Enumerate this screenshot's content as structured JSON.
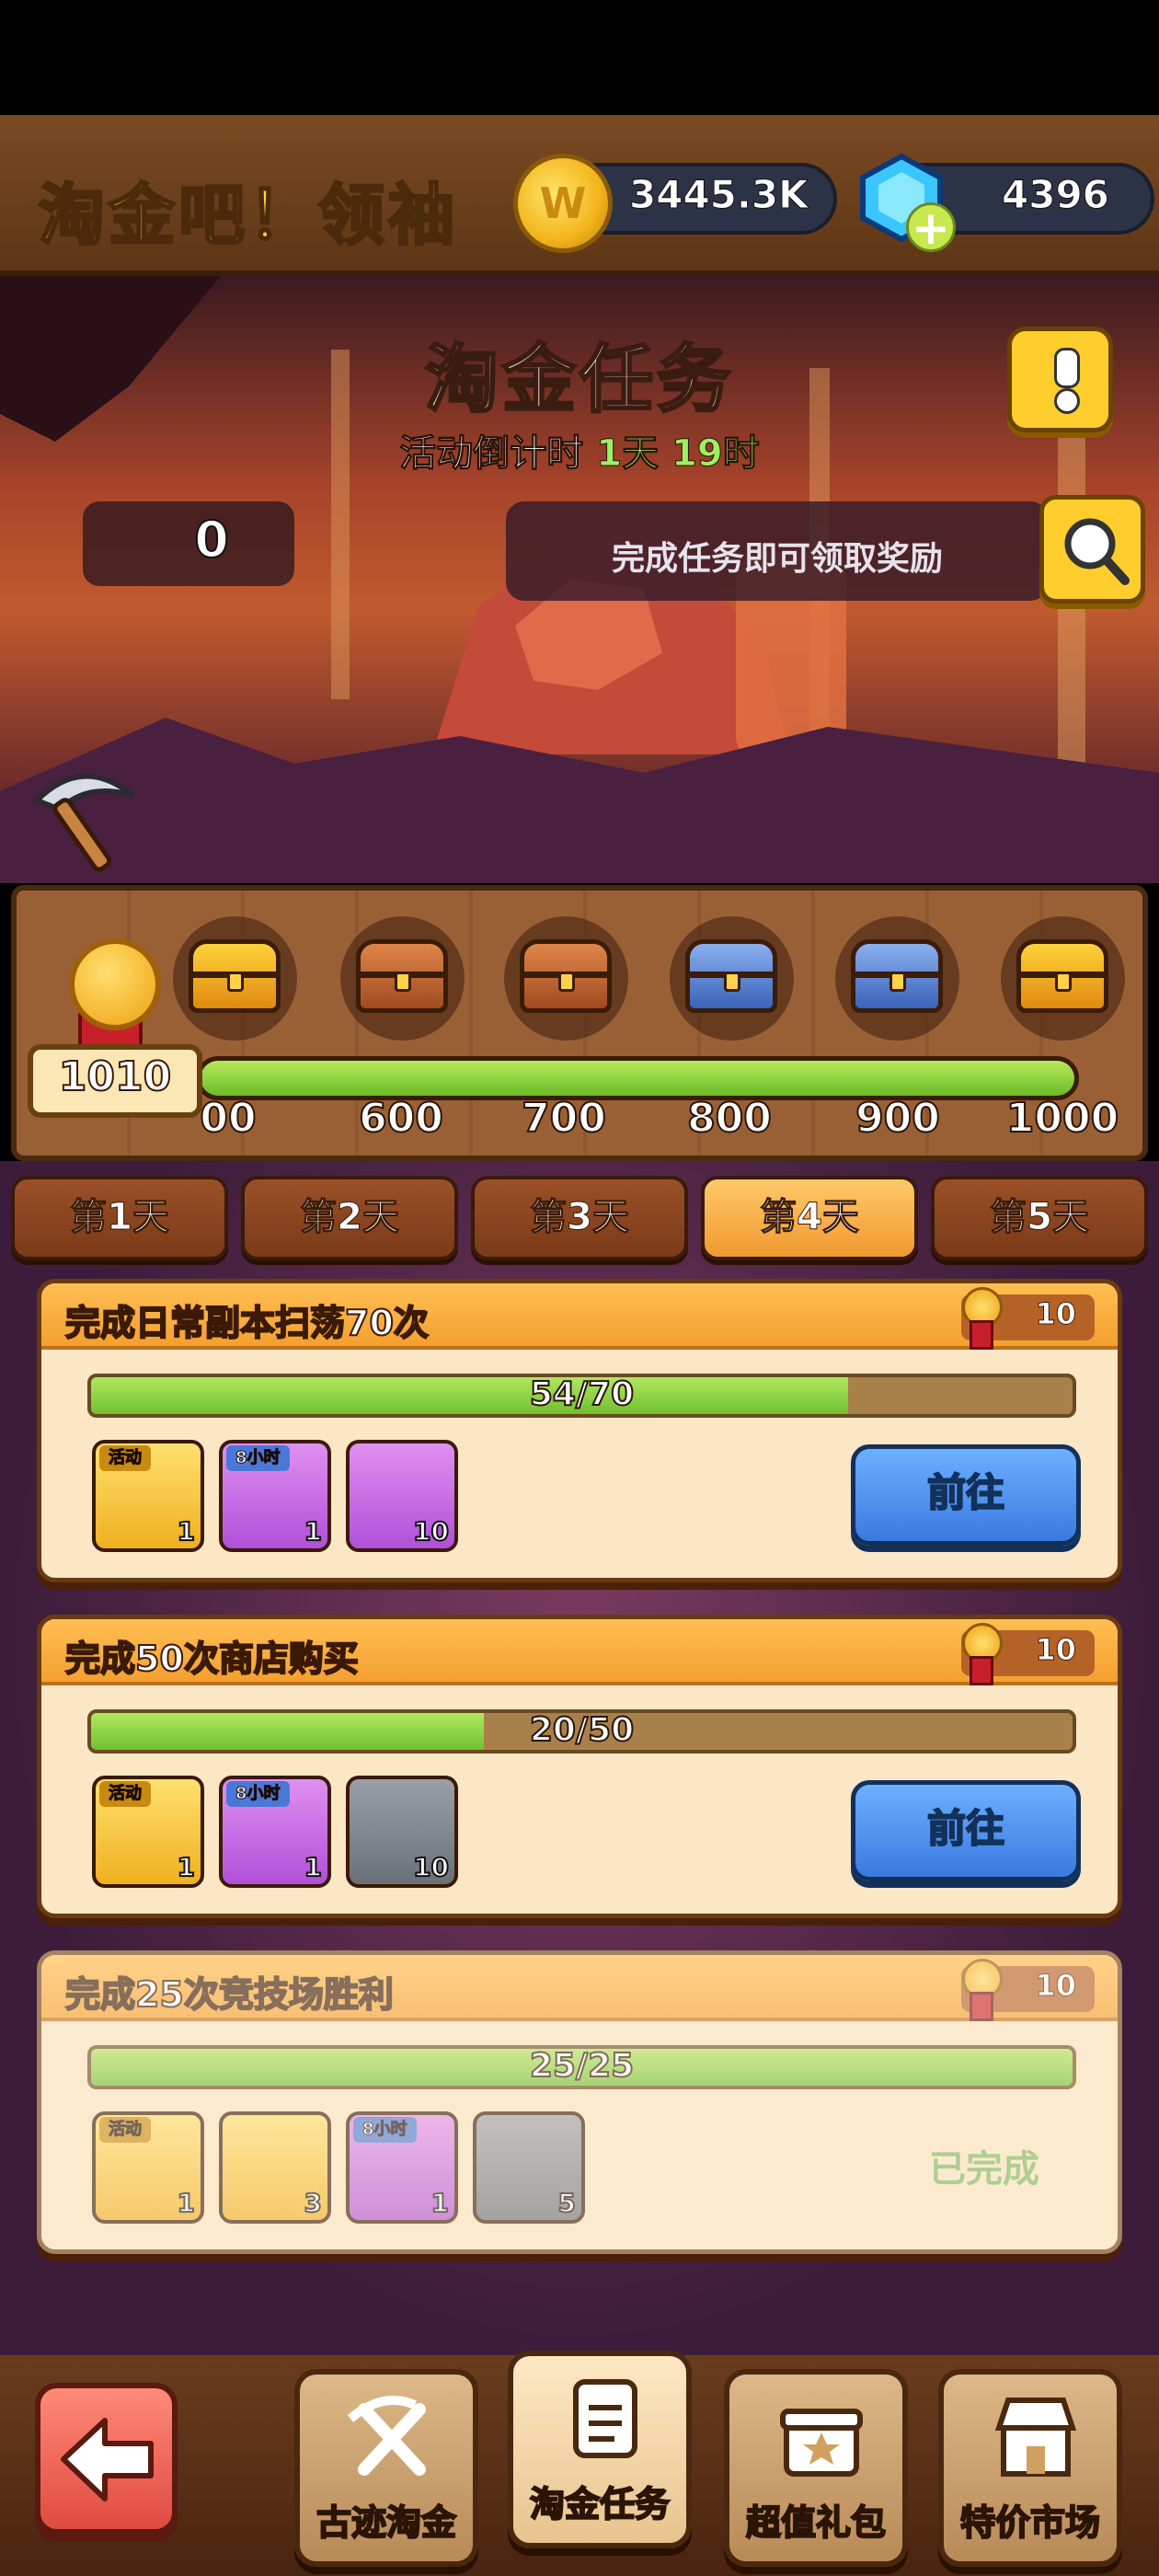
{
  "header": {
    "title": "淘金吧！领袖",
    "coins": "3445.3K",
    "gems": "4396"
  },
  "event": {
    "title": "淘金任务",
    "countdown_label": "活动倒计时",
    "countdown_value": "1天 19时",
    "pickaxe_count": "0",
    "hint": "完成任务即可领取奖励"
  },
  "track": {
    "current_score": "1010",
    "progress_fraction": 1.0,
    "milestones": [
      "00",
      "600",
      "700",
      "800",
      "900",
      "1000"
    ]
  },
  "days": [
    "第1天",
    "第2天",
    "第3天",
    "第4天",
    "第5天"
  ],
  "active_day_index": 3,
  "tasks": [
    {
      "title": "完成日常副本扫荡70次",
      "points": "10",
      "progress": "54/70",
      "fraction": 0.7714,
      "button": "前往",
      "rewards": [
        {
          "icon": "pickaxe-icon",
          "tag": "活动",
          "count": "1"
        },
        {
          "icon": "blue-crystals-icon",
          "tag": "8小时",
          "count": "1"
        },
        {
          "icon": "purple-coin-icon",
          "tag": "",
          "count": "10"
        }
      ]
    },
    {
      "title": "完成50次商店购买",
      "points": "10",
      "progress": "20/50",
      "fraction": 0.4,
      "button": "前往",
      "rewards": [
        {
          "icon": "pickaxe-icon",
          "tag": "活动",
          "count": "1"
        },
        {
          "icon": "gold-bag-icon",
          "tag": "8小时",
          "count": "1"
        },
        {
          "icon": "wooden-chest-icon",
          "tag": "",
          "count": "10"
        }
      ]
    },
    {
      "title": "完成25次竞技场胜利",
      "points": "10",
      "progress": "25/25",
      "fraction": 1.0,
      "status": "已完成",
      "rewards": [
        {
          "icon": "pickaxe-icon",
          "tag": "活动",
          "count": "1"
        },
        {
          "icon": "gold-ore-icon",
          "tag": "",
          "count": "3"
        },
        {
          "icon": "purple-ore-bag-icon",
          "tag": "8小时",
          "count": "1"
        },
        {
          "icon": "map-scroll-icon",
          "tag": "",
          "count": "5"
        }
      ]
    }
  ],
  "nav": [
    "古迹淘金",
    "淘金任务",
    "超值礼包",
    "特价市场"
  ],
  "colors": {
    "accent": "#f4a030",
    "go_button": "#3a7ae0",
    "progress": "#70c030",
    "gold": "#ffd23a"
  }
}
